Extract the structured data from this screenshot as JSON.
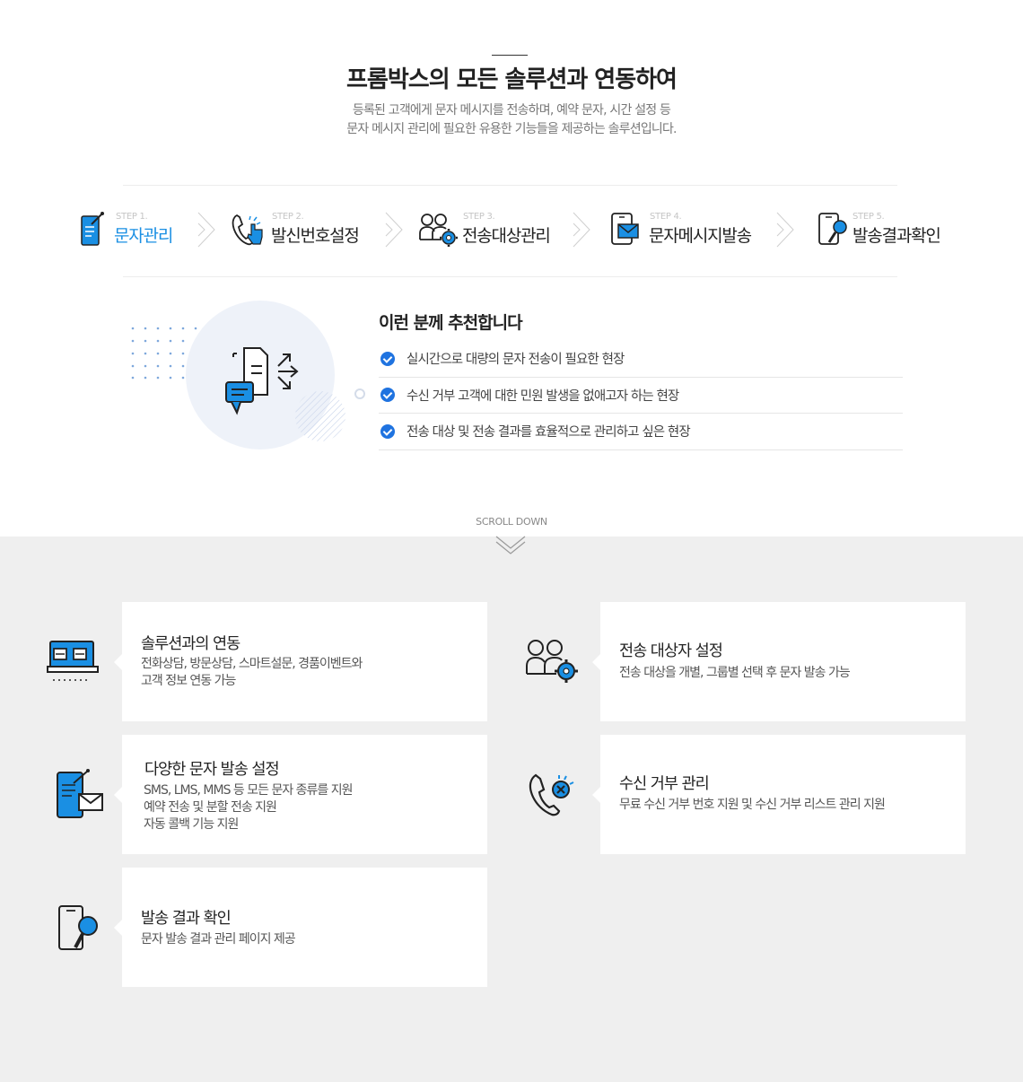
{
  "header": {
    "title": "프롬박스의 모든 솔루션과 연동하여",
    "desc_line1": "등록된 고객에게 문자 메시지를 전송하며, 예약 문자, 시간 설정 등",
    "desc_line2": "문자 메시지 관리에 필요한 유용한 기능들을 제공하는 솔루션입니다."
  },
  "steps": [
    {
      "num": "STEP 1.",
      "label": "문자관리",
      "icon": "phone-edit-icon",
      "active": true
    },
    {
      "num": "STEP 2.",
      "label": "발신번호설정",
      "icon": "phone-touch-icon"
    },
    {
      "num": "STEP 3.",
      "label": "전송대상관리",
      "icon": "users-gear-icon"
    },
    {
      "num": "STEP 4.",
      "label": "문자메시지발송",
      "icon": "phone-mail-icon"
    },
    {
      "num": "STEP 5.",
      "label": "발송결과확인",
      "icon": "phone-search-icon"
    }
  ],
  "recommend": {
    "title": "이런 분께 추천합니다",
    "items": [
      "실시간으로 대량의 문자 전송이 필요한 현장",
      "수신 거부 고객에 대한 민원 발생을 없애고자 하는 현장",
      "전송 대상 및 전송 결과를 효율적으로 관리하고 싶은 현장"
    ]
  },
  "scroll": {
    "label": "SCROLL DOWN"
  },
  "features": [
    {
      "title": "솔루션과의 연동",
      "desc": "전화상담, 방문상담, 스마트설문, 경품이벤트와\n고객 정보 연동 가능",
      "icon": "monitor-icon"
    },
    {
      "title": "전송 대상자 설정",
      "desc": "전송 대상을 개별, 그룹별 선택 후 문자 발송 가능",
      "icon": "users-gear-icon"
    },
    {
      "title": "다양한 문자 발송 설정",
      "desc": "SMS, LMS, MMS 등 모든 문자 종류를 지원\n예약 전송 및 분할 전송 지원\n자동 콜백 기능 지원",
      "icon": "phone-mail-icon"
    },
    {
      "title": "수신 거부 관리",
      "desc": "무료 수신 거부 번호 지원 및 수신 거부 리스트 관리 지원",
      "icon": "phone-block-icon"
    },
    {
      "title": "발송 결과 확인",
      "desc": "문자 발송 결과 관리 페이지 제공",
      "icon": "phone-search-icon"
    }
  ],
  "colors": {
    "accent": "#1a8fe3",
    "check": "#1f73e0",
    "gray_bg": "#efefef"
  }
}
